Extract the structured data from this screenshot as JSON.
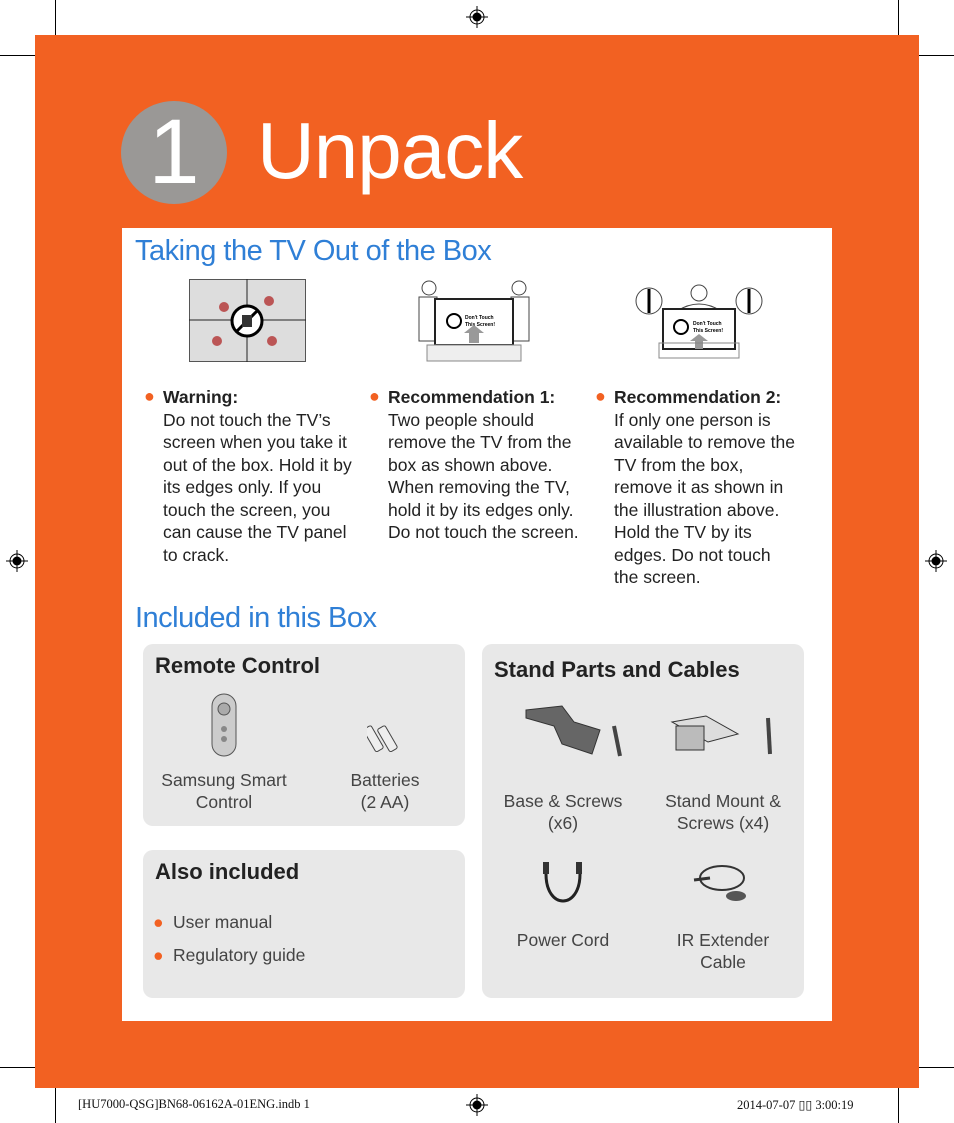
{
  "page": {
    "step_number": "1",
    "title": "Unpack"
  },
  "section1": {
    "heading": "Taking the TV Out of the Box",
    "illustration_text": [
      "Don't Touch",
      "This Screen!"
    ],
    "columns": [
      {
        "heading": "Warning:",
        "body": "Do not touch the TV’s screen when you take it out of the box. Hold it by its edges only. If you touch the screen, you can cause the TV panel to crack."
      },
      {
        "heading": "Recommendation 1:",
        "body": "Two people should remove the TV from the box as shown above. When removing the TV, hold it by its edges only. Do not touch the screen."
      },
      {
        "heading": "Recommendation 2:",
        "body": "If only one person is available to remove the TV from the box, remove it as shown in the illustration above. Hold the TV by its edges. Do not touch the screen."
      }
    ]
  },
  "section2": {
    "heading": "Included in this Box",
    "remote": {
      "title": "Remote Control",
      "items": [
        "Samsung Smart Control",
        "Batteries (2 AA)"
      ]
    },
    "also": {
      "title": "Also included",
      "items": [
        "User manual",
        "Regulatory guide"
      ]
    },
    "stand": {
      "title": "Stand Parts and Cables",
      "items": [
        "Base & Screws (x6)",
        "Stand Mount & Screws (x4)",
        "Power Cord",
        "IR Extender Cable"
      ]
    }
  },
  "footer": {
    "file": "[HU7000-QSG]BN68-06162A-01ENG.indb   1",
    "date": "2014-07-07   ▯▯ 3:00:19"
  },
  "colors": {
    "accent": "#F26122",
    "heading": "#2f7fd6",
    "box": "#e8e8e8"
  }
}
